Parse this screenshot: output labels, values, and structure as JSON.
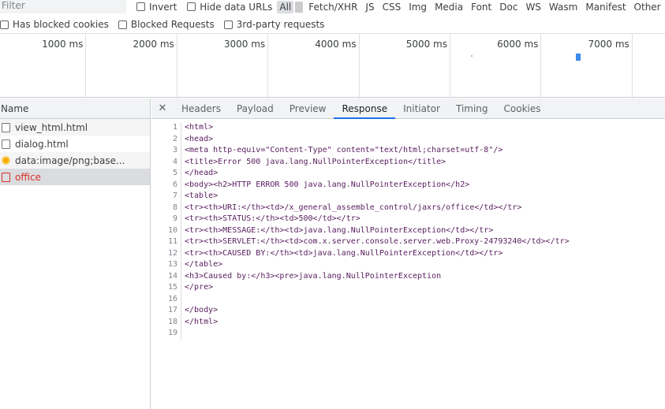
{
  "toolbar": {
    "filter_placeholder": "Filter",
    "invert": "Invert",
    "hide_data_urls": "Hide data URLs",
    "types": [
      "All",
      "Fetch/XHR",
      "JS",
      "CSS",
      "Img",
      "Media",
      "Font",
      "Doc",
      "WS",
      "Wasm",
      "Manifest",
      "Other"
    ],
    "selected_type": "All"
  },
  "filters2": [
    "Has blocked cookies",
    "Blocked Requests",
    "3rd-party requests"
  ],
  "timeline": {
    "ticks": [
      "1000 ms",
      "2000 ms",
      "3000 ms",
      "4000 ms",
      "5000 ms",
      "6000 ms",
      "7000 ms"
    ]
  },
  "requests": {
    "header": "Name",
    "items": [
      {
        "name": "view_html.html",
        "type": "doc"
      },
      {
        "name": "dialog.html",
        "type": "doc"
      },
      {
        "name": "data:image/png;base...",
        "type": "image"
      },
      {
        "name": "office",
        "type": "error",
        "selected": true
      }
    ]
  },
  "detail": {
    "tabs": [
      "Headers",
      "Payload",
      "Preview",
      "Response",
      "Initiator",
      "Timing",
      "Cookies"
    ],
    "active_tab": "Response",
    "lines": [
      "<html>",
      "<head>",
      "<meta http-equiv=\"Content-Type\" content=\"text/html;charset=utf-8\"/>",
      "<title>Error 500 java.lang.NullPointerException</title>",
      "</head>",
      "<body><h2>HTTP ERROR 500 java.lang.NullPointerException</h2>",
      "<table>",
      "<tr><th>URI:</th><td>/x_general_assemble_control/jaxrs/office</td></tr>",
      "<tr><th>STATUS:</th><td>500</td></tr>",
      "<tr><th>MESSAGE:</th><td>java.lang.NullPointerException</td></tr>",
      "<tr><th>SERVLET:</th><td>com.x.server.console.server.web.Proxy-24793240</td></tr>",
      "<tr><th>CAUSED BY:</th><td>java.lang.NullPointerException</td></tr>",
      "</table>",
      "<h3>Caused by:</h3><pre>java.lang.NullPointerException",
      "</pre>",
      "",
      "</body>",
      "</html>",
      ""
    ]
  },
  "colors": {
    "accent": "#1a73e8",
    "error": "#d93025",
    "tag": "#881280",
    "attr_name": "#994500",
    "attr_value": "#1a1aa6"
  }
}
